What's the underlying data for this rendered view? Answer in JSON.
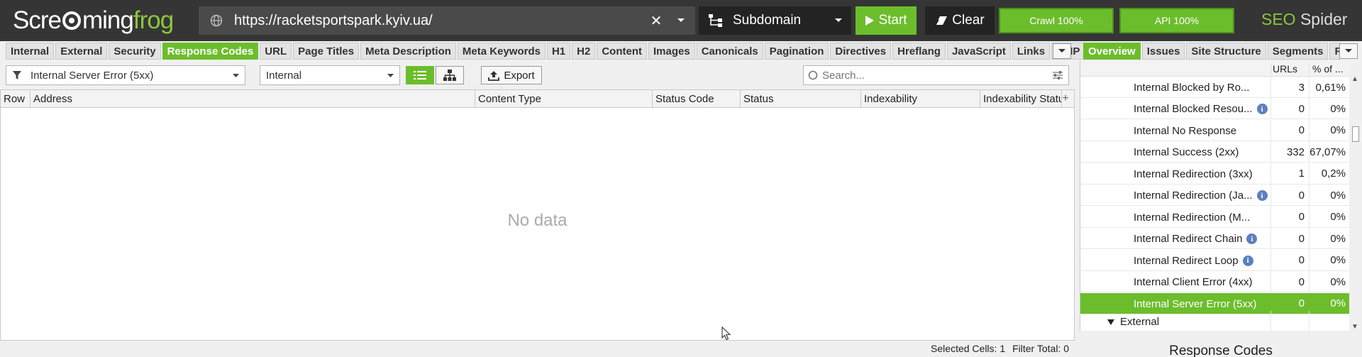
{
  "app": {
    "brand_seo": "SEO",
    "brand_spider": " Spider",
    "logo_a": "Scre",
    "logo_b": "ming",
    "logo_c": "frog"
  },
  "toolbar": {
    "url": "https://racketsportspark.kyiv.ua/",
    "mode_label": "Subdomain",
    "start_label": "Start",
    "clear_label": "Clear",
    "crawl_progress_label": "Crawl 100%",
    "api_progress_label": "API 100%",
    "crawl_progress": 100,
    "api_progress": 100
  },
  "tabs": [
    "Internal",
    "External",
    "Security",
    "Response Codes",
    "URL",
    "Page Titles",
    "Meta Description",
    "Meta Keywords",
    "H1",
    "H2",
    "Content",
    "Images",
    "Canonicals",
    "Pagination",
    "Directives",
    "Hreflang",
    "JavaScript",
    "Links",
    "AMP"
  ],
  "active_tab": "Response Codes",
  "filters": {
    "filter_value": "Internal Server Error (5xx)",
    "scope_value": "Internal",
    "export_label": "Export",
    "search_placeholder": "Search..."
  },
  "grid": {
    "columns": [
      "Row",
      "Address",
      "Content Type",
      "Status Code",
      "Status",
      "Indexability",
      "Indexability Status"
    ],
    "empty_text": "No data",
    "status_selected": "Selected Cells:  1",
    "status_filter": "Filter Total:  0"
  },
  "right_tabs": [
    "Overview",
    "Issues",
    "Site Structure",
    "Segments",
    "Response Times"
  ],
  "right_tabs_visible": [
    "Overview",
    "Issues",
    "Site Structure",
    "Segments",
    "Re"
  ],
  "overview": {
    "header_urls": "URLs",
    "header_pct": "% of ...",
    "rows": [
      {
        "name": "Internal Blocked by Ro...",
        "urls": "3",
        "pct": "0,61%",
        "info": false,
        "selected": false
      },
      {
        "name": "Internal Blocked Resou...",
        "urls": "0",
        "pct": "0%",
        "info": true,
        "selected": false
      },
      {
        "name": "Internal No Response",
        "urls": "0",
        "pct": "0%",
        "info": false,
        "selected": false
      },
      {
        "name": "Internal Success (2xx)",
        "urls": "332",
        "pct": "67,07%",
        "info": false,
        "selected": false
      },
      {
        "name": "Internal Redirection (3xx)",
        "urls": "1",
        "pct": "0,2%",
        "info": false,
        "selected": false
      },
      {
        "name": "Internal Redirection (Ja...",
        "urls": "0",
        "pct": "0%",
        "info": true,
        "selected": false
      },
      {
        "name": "Internal Redirection (M...",
        "urls": "0",
        "pct": "0%",
        "info": false,
        "selected": false
      },
      {
        "name": "Internal Redirect Chain",
        "urls": "0",
        "pct": "0%",
        "info": true,
        "selected": false
      },
      {
        "name": "Internal Redirect Loop",
        "urls": "0",
        "pct": "0%",
        "info": true,
        "selected": false
      },
      {
        "name": "Internal Client Error (4xx)",
        "urls": "0",
        "pct": "0%",
        "info": false,
        "selected": false
      },
      {
        "name": "Internal Server Error (5xx)",
        "urls": "0",
        "pct": "0%",
        "info": false,
        "selected": true
      }
    ],
    "group_external": "External",
    "chart_title": "Response Codes"
  },
  "colors": {
    "accent": "#6cbd2c",
    "topbar": "#353535",
    "info_icon": "#5b7fc0"
  }
}
